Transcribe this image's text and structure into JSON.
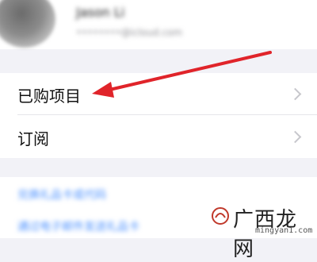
{
  "profile": {
    "name": "Jason Li",
    "email": "••••••••@icloud.com"
  },
  "menu": {
    "items": [
      {
        "label": "已购项目"
      },
      {
        "label": "订阅"
      }
    ]
  },
  "links": [
    "兑换礼品卡或代码",
    "通过电子邮件发送礼品卡"
  ],
  "watermark": {
    "text": "广西龙网",
    "sub": "mingyan1.com"
  },
  "colors": {
    "background": "#f2f2f7",
    "arrow": "#e0242a",
    "link": "#4a90ff",
    "chevron": "#c7c7cc"
  }
}
